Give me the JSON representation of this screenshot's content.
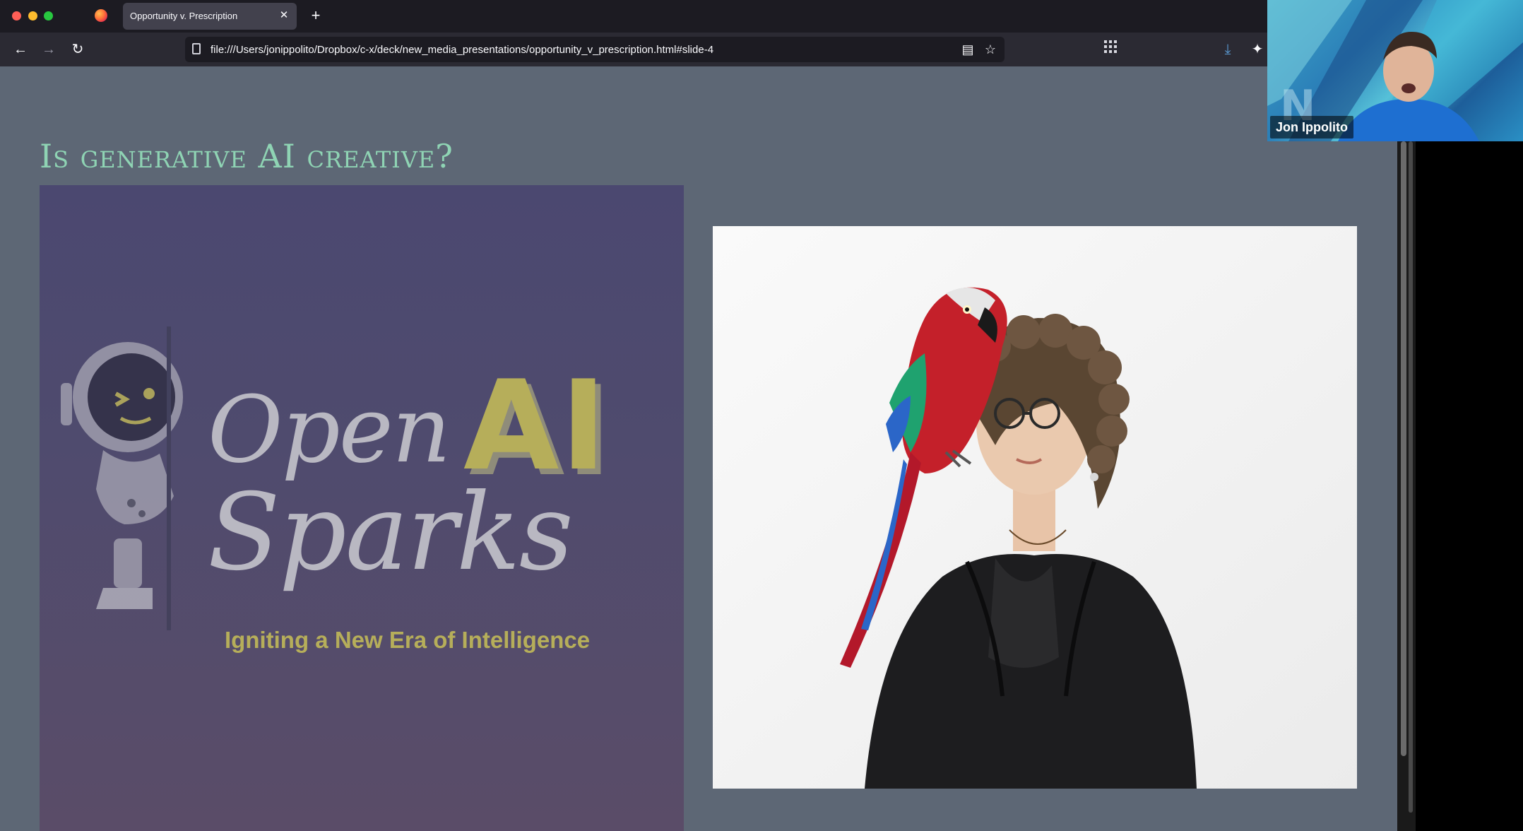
{
  "browser": {
    "tab": {
      "title": "Opportunity v. Prescription",
      "close_label": "✕"
    },
    "new_tab_label": "+",
    "url": "file:///Users/jonippolito/Dropbox/c-x/deck/new_media_presentations/opportunity_v_prescription.html#slide-4",
    "icons": {
      "back": "←",
      "forward": "→",
      "reload": "↻",
      "reader": "▤",
      "star": "☆",
      "apps": "⋮⋮⋮",
      "download": "⤓",
      "extension": "✦"
    }
  },
  "slide": {
    "title": "Is generative AI creative?",
    "left_image": {
      "brand_open": "Open",
      "brand_ai": "AI",
      "brand_sparks": "Sparks",
      "tagline": "Igniting a New Era of Intelligence"
    },
    "right_image": {
      "description_icon": "woman-with-parrot-photo"
    }
  },
  "video_call": {
    "participant_name": "Jon Ippolito"
  },
  "colors": {
    "slide_background": "#5d6775",
    "title_accent": "#8fd4b4",
    "brand_gold": "#b6ae5a"
  }
}
